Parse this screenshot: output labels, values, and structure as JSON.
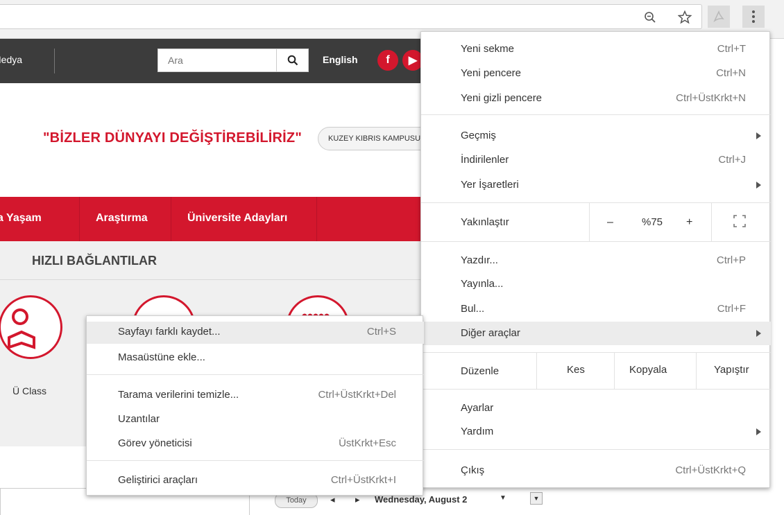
{
  "toolbar": {
    "zoom_icon": "zoom-out-icon",
    "star_icon": "star-icon",
    "extension_icon": "pdf-extension-icon",
    "menu_icon": "more-vert-icon"
  },
  "page": {
    "topbar": {
      "media_label": "Medya",
      "search_placeholder": "Ara",
      "language_label": "English"
    },
    "slogan": "\"BİZLER DÜNYAYI DEĞİŞTİREBİLİRİZ\"",
    "campus_button": "KUZEY KIBRIS KAMPUSU",
    "nav": [
      "a Yaşam",
      "Araştırma",
      "Üniversite Adayları"
    ],
    "quick_links_title": "HIZLI BAĞLANTILAR",
    "quick_link_label": "Ü Class",
    "calendar": {
      "today": "Today",
      "date": "Wednesday, August 2"
    }
  },
  "chrome_menu": {
    "new_tab": {
      "label": "Yeni sekme",
      "shortcut": "Ctrl+T"
    },
    "new_window": {
      "label": "Yeni pencere",
      "shortcut": "Ctrl+N"
    },
    "incognito": {
      "label": "Yeni gizli pencere",
      "shortcut": "Ctrl+ÜstKrkt+N"
    },
    "history": {
      "label": "Geçmiş"
    },
    "downloads": {
      "label": "İndirilenler",
      "shortcut": "Ctrl+J"
    },
    "bookmarks": {
      "label": "Yer İşaretleri"
    },
    "zoom": {
      "label": "Yakınlaştır",
      "minus": "–",
      "value": "%75",
      "plus": "+"
    },
    "print": {
      "label": "Yazdır...",
      "shortcut": "Ctrl+P"
    },
    "cast": {
      "label": "Yayınla..."
    },
    "find": {
      "label": "Bul...",
      "shortcut": "Ctrl+F"
    },
    "more_tools": {
      "label": "Diğer araçlar"
    },
    "edit": {
      "label": "Düzenle",
      "cut": "Kes",
      "copy": "Kopyala",
      "paste": "Yapıştır"
    },
    "settings": {
      "label": "Ayarlar"
    },
    "help": {
      "label": "Yardım"
    },
    "exit": {
      "label": "Çıkış",
      "shortcut": "Ctrl+ÜstKrkt+Q"
    }
  },
  "sub_menu": {
    "save_page": {
      "label": "Sayfayı farklı kaydet...",
      "shortcut": "Ctrl+S"
    },
    "add_desktop": {
      "label": "Masaüstüne ekle..."
    },
    "clear_data": {
      "label": "Tarama verilerini temizle...",
      "shortcut": "Ctrl+ÜstKrkt+Del"
    },
    "extensions": {
      "label": "Uzantılar"
    },
    "task_manager": {
      "label": "Görev yöneticisi",
      "shortcut": "ÜstKrkt+Esc"
    },
    "dev_tools": {
      "label": "Geliştirici araçları",
      "shortcut": "Ctrl+ÜstKrkt+I"
    }
  }
}
